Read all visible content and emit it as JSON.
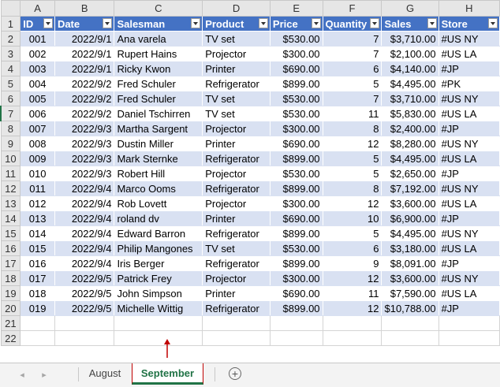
{
  "columns": [
    "A",
    "B",
    "C",
    "D",
    "E",
    "F",
    "G",
    "H"
  ],
  "table": {
    "headers": [
      "ID",
      "Date",
      "Salesman",
      "Product",
      "Price",
      "Quantity",
      "Sales",
      "Store"
    ],
    "rows": [
      [
        "001",
        "2022/9/1",
        "Ana varela",
        "TV set",
        "$530.00",
        "7",
        "$3,710.00",
        "#US NY"
      ],
      [
        "002",
        "2022/9/1",
        "Rupert Hains",
        "Projector",
        "$300.00",
        "7",
        "$2,100.00",
        "#US LA"
      ],
      [
        "003",
        "2022/9/1",
        "Ricky Kwon",
        "Printer",
        "$690.00",
        "6",
        "$4,140.00",
        "#JP"
      ],
      [
        "004",
        "2022/9/2",
        "Fred Schuler",
        "Refrigerator",
        "$899.00",
        "5",
        "$4,495.00",
        "#PK"
      ],
      [
        "005",
        "2022/9/2",
        "Fred Schuler",
        "TV set",
        "$530.00",
        "7",
        "$3,710.00",
        "#US NY"
      ],
      [
        "006",
        "2022/9/2",
        "Daniel Tschirren",
        "TV set",
        "$530.00",
        "11",
        "$5,830.00",
        "#US LA"
      ],
      [
        "007",
        "2022/9/3",
        "Martha Sargent",
        "Projector",
        "$300.00",
        "8",
        "$2,400.00",
        "#JP"
      ],
      [
        "008",
        "2022/9/3",
        "Dustin Miller",
        "Printer",
        "$690.00",
        "12",
        "$8,280.00",
        "#US NY"
      ],
      [
        "009",
        "2022/9/3",
        "Mark Sternke",
        "Refrigerator",
        "$899.00",
        "5",
        "$4,495.00",
        "#US LA"
      ],
      [
        "010",
        "2022/9/3",
        "Robert Hill",
        "Projector",
        "$530.00",
        "5",
        "$2,650.00",
        "#JP"
      ],
      [
        "011",
        "2022/9/4",
        "Marco Ooms",
        "Refrigerator",
        "$899.00",
        "8",
        "$7,192.00",
        "#US NY"
      ],
      [
        "012",
        "2022/9/4",
        "Rob Lovett",
        "Projector",
        "$300.00",
        "12",
        "$3,600.00",
        "#US LA"
      ],
      [
        "013",
        "2022/9/4",
        "roland dv",
        "Printer",
        "$690.00",
        "10",
        "$6,900.00",
        "#JP"
      ],
      [
        "014",
        "2022/9/4",
        "Edward Barron",
        "Refrigerator",
        "$899.00",
        "5",
        "$4,495.00",
        "#US NY"
      ],
      [
        "015",
        "2022/9/4",
        "Philip Mangones",
        "TV set",
        "$530.00",
        "6",
        "$3,180.00",
        "#US LA"
      ],
      [
        "016",
        "2022/9/4",
        "Iris Berger",
        "Refrigerator",
        "$899.00",
        "9",
        "$8,091.00",
        "#JP"
      ],
      [
        "017",
        "2022/9/5",
        "Patrick Frey",
        "Projector",
        "$300.00",
        "12",
        "$3,600.00",
        "#US NY"
      ],
      [
        "018",
        "2022/9/5",
        "John Simpson",
        "Printer",
        "$690.00",
        "11",
        "$7,590.00",
        "#US LA"
      ],
      [
        "019",
        "2022/9/5",
        "Michelle Wittig",
        "Refrigerator",
        "$899.00",
        "12",
        "$10,788.00",
        "#JP"
      ]
    ]
  },
  "row_numbers": [
    "1",
    "2",
    "3",
    "4",
    "5",
    "6",
    "7",
    "8",
    "9",
    "10",
    "11",
    "12",
    "13",
    "14",
    "15",
    "16",
    "17",
    "18",
    "19",
    "20",
    "21",
    "22"
  ],
  "sheet_tabs": {
    "prev_icon": "◂",
    "next_icon": "▸",
    "tabs": [
      "August",
      "September"
    ],
    "active": "September",
    "add_icon": "+"
  },
  "colors": {
    "header_fill": "#4472c4",
    "band_fill": "#d9e1f2",
    "active_tab_text": "#217346",
    "annotation_arrow": "#c00000"
  }
}
